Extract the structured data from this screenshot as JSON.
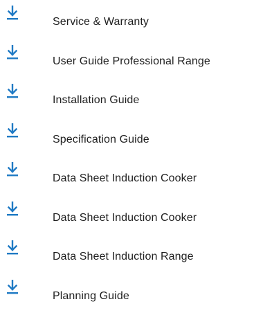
{
  "downloads": {
    "accent_color": "#1f7ac4",
    "text_color": "#1f1f1f",
    "items": [
      {
        "icon": "download-icon",
        "label": "Service & Warranty"
      },
      {
        "icon": "download-icon",
        "label": "User Guide Professional Range"
      },
      {
        "icon": "download-icon",
        "label": "Installation Guide"
      },
      {
        "icon": "download-icon",
        "label": "Specification Guide"
      },
      {
        "icon": "download-icon",
        "label": "Data Sheet Induction Cooker"
      },
      {
        "icon": "download-icon",
        "label": "Data Sheet Induction Cooker"
      },
      {
        "icon": "download-icon",
        "label": "Data Sheet Induction Range"
      },
      {
        "icon": "download-icon",
        "label": "Planning Guide"
      }
    ]
  }
}
